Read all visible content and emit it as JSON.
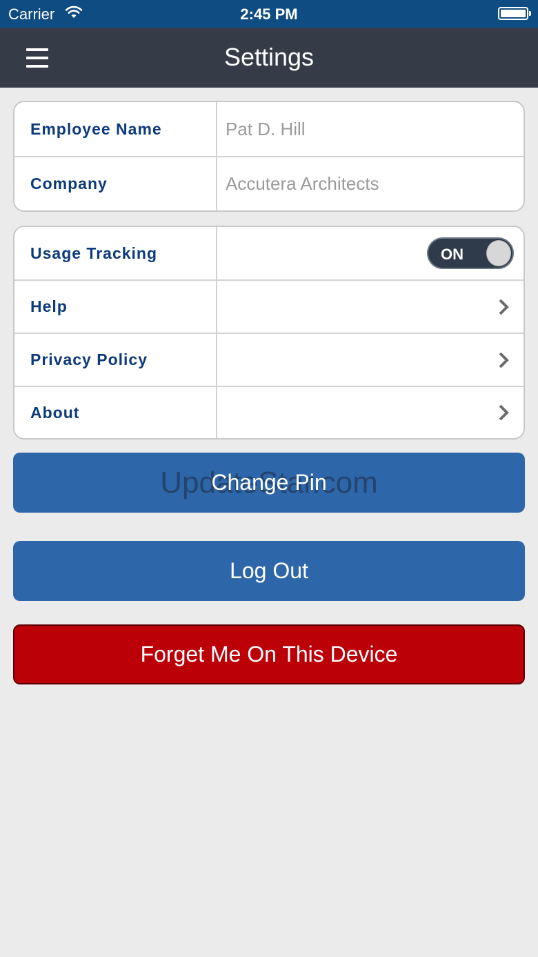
{
  "status_bar": {
    "carrier": "Carrier",
    "time": "2:45 PM"
  },
  "nav": {
    "title": "Settings",
    "menu_icon": "hamburger-menu-icon"
  },
  "profile": {
    "rows": [
      {
        "label": "Employee Name",
        "value": "Pat D. Hill"
      },
      {
        "label": "Company",
        "value": "Accutera Architects"
      }
    ]
  },
  "options": {
    "usage_tracking": {
      "label": "Usage Tracking",
      "toggle_text": "ON",
      "state": "on"
    },
    "help": {
      "label": "Help"
    },
    "privacy_policy": {
      "label": "Privacy Policy"
    },
    "about": {
      "label": "About"
    }
  },
  "buttons": {
    "change_pin": "Change Pin",
    "watermark": "UpdateStar.com",
    "log_out": "Log Out",
    "forget_me": "Forget Me On This Device"
  },
  "colors": {
    "status_bar": "#0f4c81",
    "nav_bar": "#353c47",
    "label_text": "#0c3a7a",
    "primary_button": "#2d67aa",
    "danger_button": "#bc0008",
    "background": "#ebebeb"
  }
}
